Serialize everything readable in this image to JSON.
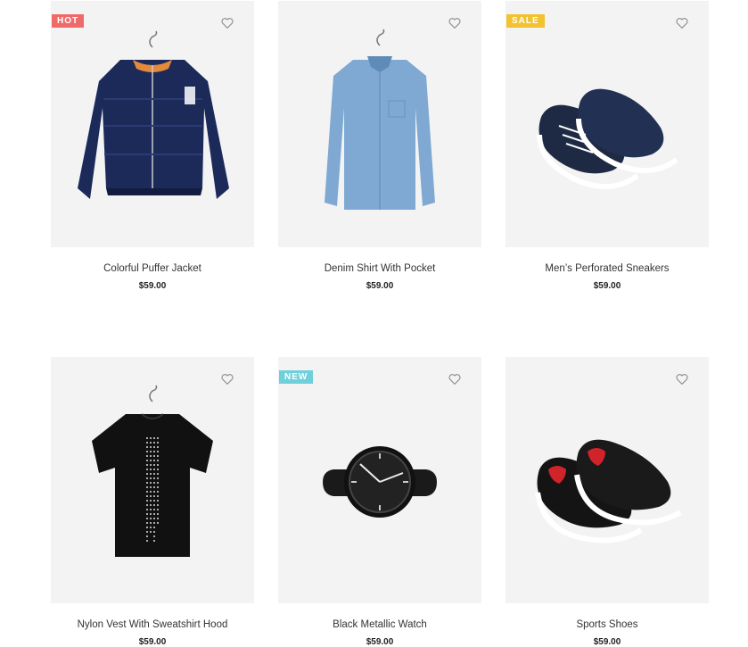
{
  "badge_colors": {
    "hot": "#f06a6a",
    "sale": "#f2c230",
    "new": "#6fd0db"
  },
  "products": [
    {
      "title": "Colorful Puffer Jacket",
      "price": "$59.00",
      "badge": "HOT",
      "badge_color": "#f06a6a",
      "image": "navy-puffer-jacket"
    },
    {
      "title": "Denim Shirt With Pocket",
      "price": "$59.00",
      "badge": "",
      "image": "denim-shirt"
    },
    {
      "title": "Men’s Perforated Sneakers",
      "price": "$59.00",
      "badge": "SALE",
      "badge_color": "#f2c230",
      "image": "navy-sneakers"
    },
    {
      "title": "Nylon Vest With Sweatshirt Hood",
      "price": "$59.00",
      "badge": "",
      "image": "black-tshirt"
    },
    {
      "title": "Black Metallic Watch",
      "price": "$59.00",
      "badge": "NEW",
      "badge_color": "#6fd0db",
      "image": "black-watch"
    },
    {
      "title": "Sports Shoes",
      "price": "$59.00",
      "badge": "",
      "image": "black-red-sport-shoes"
    }
  ],
  "wishlist_icon": "heart-outline-icon"
}
